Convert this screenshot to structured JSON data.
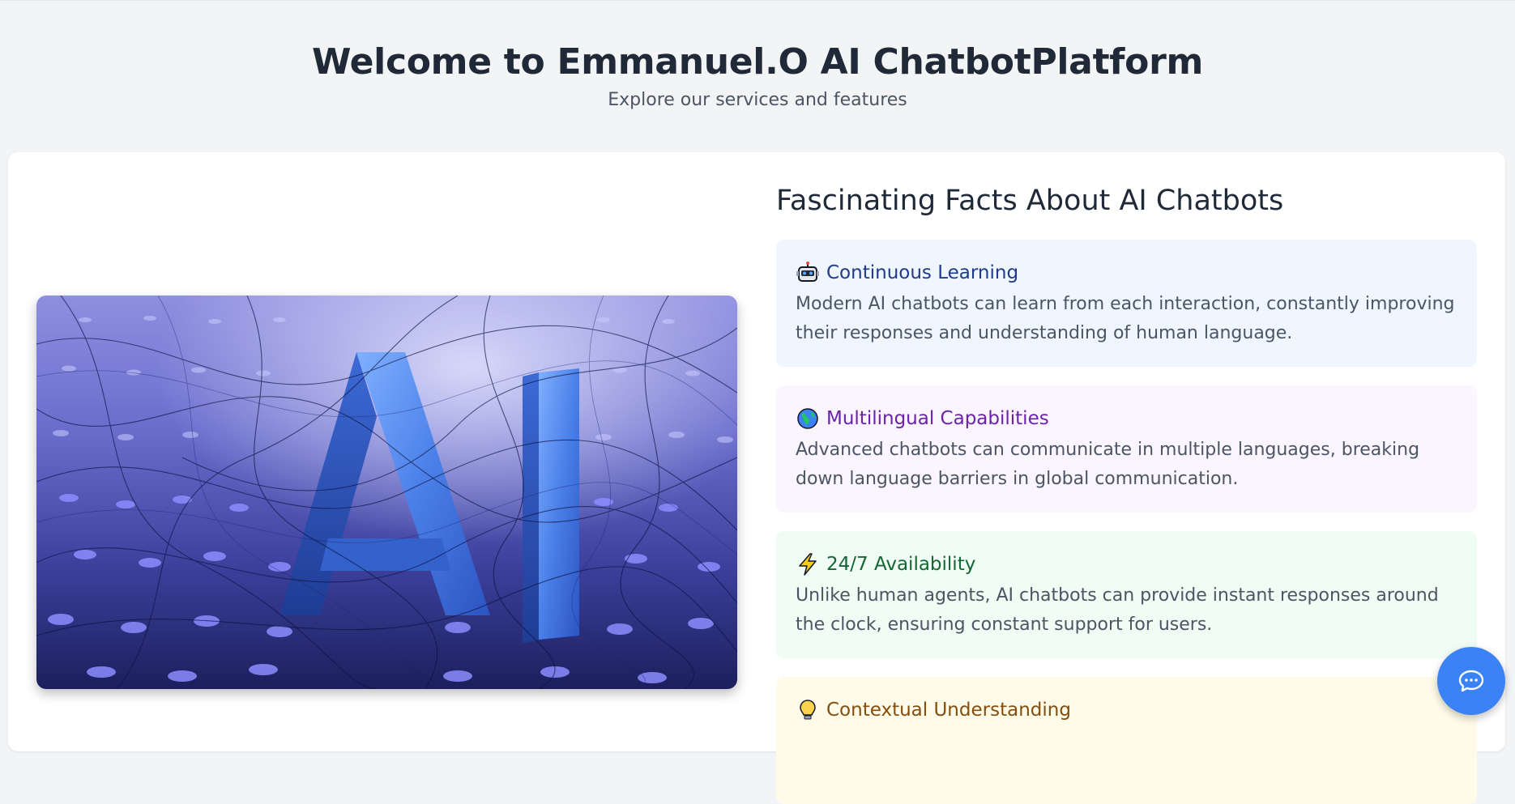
{
  "header": {
    "title": "Welcome to Emmanuel.O AI ChatbotPlatform",
    "subtitle": "Explore our services and features"
  },
  "hero": {
    "image_label": "AI"
  },
  "facts": {
    "heading": "Fascinating Facts About AI Chatbots",
    "items": [
      {
        "icon": "robot-icon",
        "title": "Continuous Learning",
        "text": "Modern AI chatbots can learn from each interaction, constantly improving their responses and understanding of human language.",
        "color": "#1e3a8a",
        "background": "#eff6ff"
      },
      {
        "icon": "globe-icon",
        "title": "Multilingual Capabilities",
        "text": "Advanced chatbots can communicate in multiple languages, breaking down language barriers in global communication.",
        "color": "#6b21a8",
        "background": "#faf5ff"
      },
      {
        "icon": "lightning-icon",
        "title": "24/7 Availability",
        "text": "Unlike human agents, AI chatbots can provide instant responses around the clock, ensuring constant support for users.",
        "color": "#166534",
        "background": "#f0fdf4"
      },
      {
        "icon": "lightbulb-icon",
        "title": "Contextual Understanding",
        "text": "",
        "color": "#854d0e",
        "background": "#fefce8"
      }
    ]
  },
  "chat_button": {
    "icon": "chat-bubble-icon",
    "color": "#3b82f6"
  }
}
